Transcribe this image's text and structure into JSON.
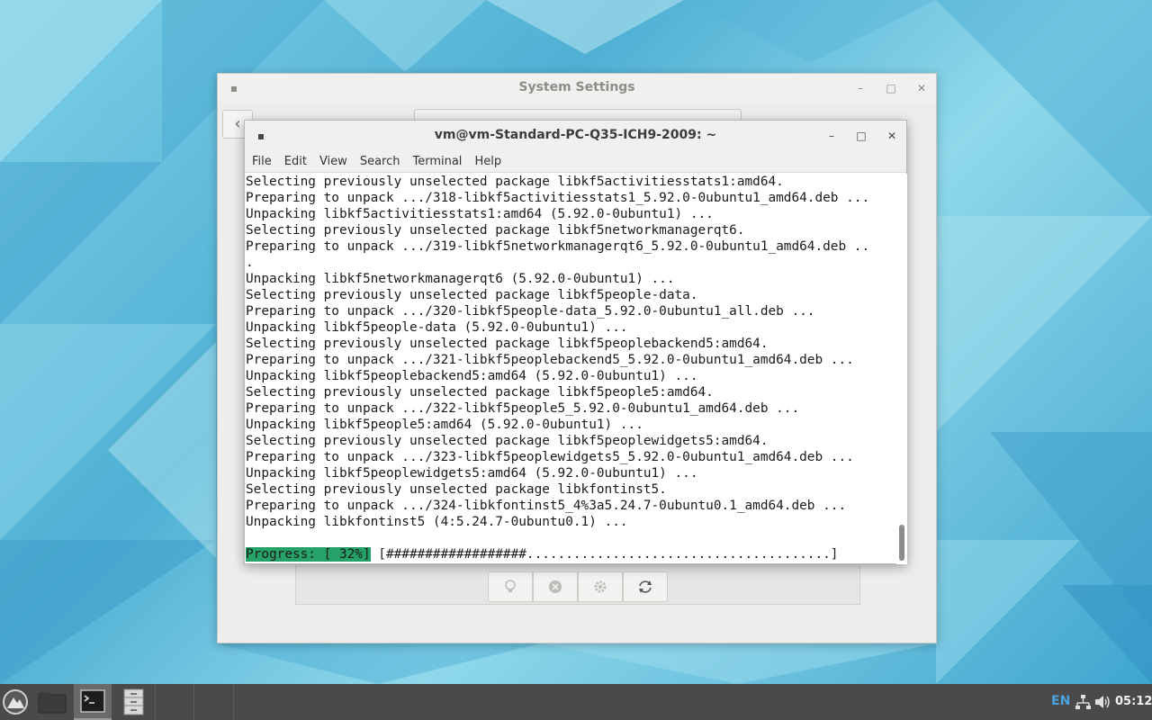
{
  "settings_window": {
    "title": "System Settings",
    "toolbar": [
      {
        "icon": "lightbulb-icon"
      },
      {
        "icon": "close-circle-icon"
      },
      {
        "icon": "gear-icon"
      },
      {
        "icon": "refresh-icon"
      }
    ]
  },
  "terminal": {
    "title": "vm@vm-Standard-PC-Q35-ICH9-2009: ~",
    "menu": [
      "File",
      "Edit",
      "View",
      "Search",
      "Terminal",
      "Help"
    ],
    "lines": [
      "Selecting previously unselected package libkf5activitiesstats1:amd64.",
      "Preparing to unpack .../318-libkf5activitiesstats1_5.92.0-0ubuntu1_amd64.deb ...",
      "Unpacking libkf5activitiesstats1:amd64 (5.92.0-0ubuntu1) ...",
      "Selecting previously unselected package libkf5networkmanagerqt6.",
      "Preparing to unpack .../319-libkf5networkmanagerqt6_5.92.0-0ubuntu1_amd64.deb ..",
      ".",
      "Unpacking libkf5networkmanagerqt6 (5.92.0-0ubuntu1) ...",
      "Selecting previously unselected package libkf5people-data.",
      "Preparing to unpack .../320-libkf5people-data_5.92.0-0ubuntu1_all.deb ...",
      "Unpacking libkf5people-data (5.92.0-0ubuntu1) ...",
      "Selecting previously unselected package libkf5peoplebackend5:amd64.",
      "Preparing to unpack .../321-libkf5peoplebackend5_5.92.0-0ubuntu1_amd64.deb ...",
      "Unpacking libkf5peoplebackend5:amd64 (5.92.0-0ubuntu1) ...",
      "Selecting previously unselected package libkf5people5:amd64.",
      "Preparing to unpack .../322-libkf5people5_5.92.0-0ubuntu1_amd64.deb ...",
      "Unpacking libkf5people5:amd64 (5.92.0-0ubuntu1) ...",
      "Selecting previously unselected package libkf5peoplewidgets5:amd64.",
      "Preparing to unpack .../323-libkf5peoplewidgets5_5.92.0-0ubuntu1_amd64.deb ...",
      "Unpacking libkf5peoplewidgets5:amd64 (5.92.0-0ubuntu1) ...",
      "Selecting previously unselected package libkfontinst5.",
      "Preparing to unpack .../324-libkfontinst5_4%3a5.24.7-0ubuntu0.1_amd64.deb ...",
      "Unpacking libkfontinst5 (4:5.24.7-0ubuntu0.1) ...",
      ""
    ],
    "progress_label": "Progress: [ 32%]",
    "progress_bar": " [##################.......................................]",
    "progress_percent": 32,
    "progress_color": "#26a269"
  },
  "taskbar": {
    "launcher_icon": "mountain-logo-icon",
    "apps": [
      {
        "name": "file-manager-icon"
      },
      {
        "name": "terminal-icon"
      },
      {
        "name": "file-cabinet-icon"
      }
    ],
    "tray": {
      "language": "EN",
      "network_icon": "network-icon",
      "volume_icon": "volume-icon",
      "clock": "05:12"
    }
  }
}
